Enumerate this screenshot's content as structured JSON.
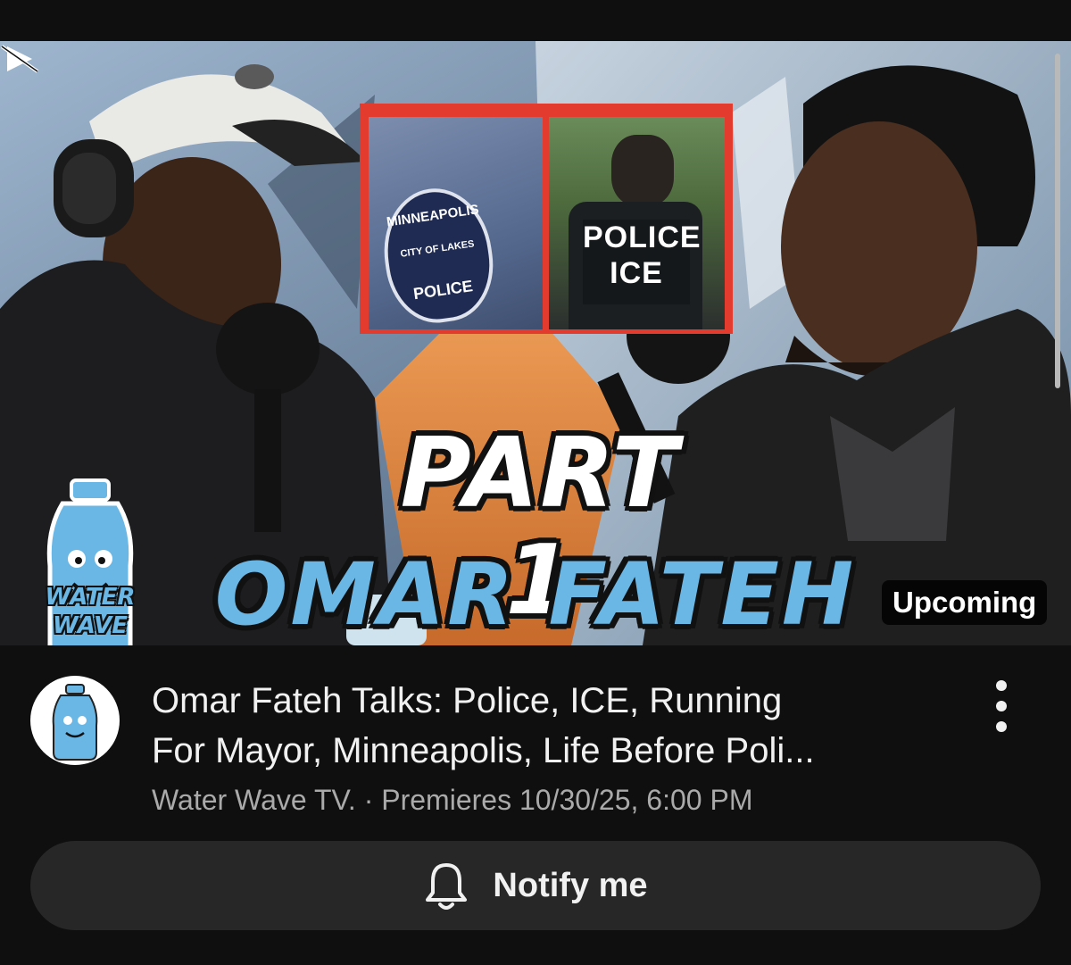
{
  "thumbnail": {
    "title_line1": "PART 1",
    "title_line2": "OMAR FATEH",
    "inset_left_patch_top": "MINNEAPOLIS",
    "inset_left_patch_mid": "CITY OF LAKES",
    "inset_left_patch_bottom": "POLICE",
    "inset_right_vest_line1": "POLICE",
    "inset_right_vest_line2": "ICE",
    "logo_line1": "WATER",
    "logo_line2": "WAVE",
    "status_badge": "Upcoming",
    "accent_color": "#6ab7e6",
    "inset_border_color": "#e43b2f"
  },
  "video": {
    "title_line1": "Omar Fateh Talks: Police, ICE, Running",
    "title_line2": "For Mayor, Minneapolis, Life Before Poli...",
    "meta": "Water Wave TV. · Premieres 10/30/25, 6:00 PM",
    "avatar_icon": "channel-avatar",
    "more_icon": "more-vert-icon"
  },
  "notify": {
    "label": "Notify me",
    "icon": "bell-icon"
  }
}
